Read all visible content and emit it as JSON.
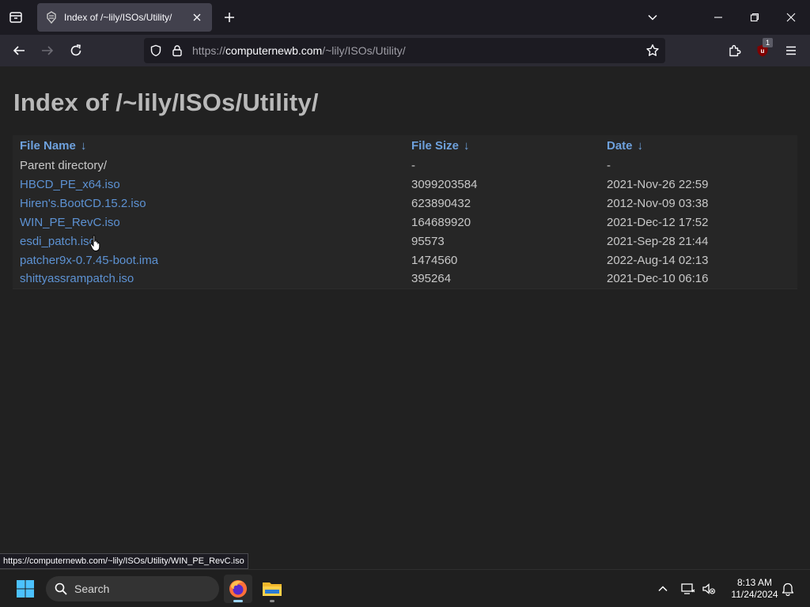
{
  "browser": {
    "tab_title": "Index of /~lily/ISOs/Utility/",
    "url_scheme": "https://",
    "url_host": "computernewb.com",
    "url_path": "/~lily/ISOs/Utility/",
    "extension_badge": "1"
  },
  "page": {
    "title": "Index of /~lily/ISOs/Utility/",
    "columns": [
      {
        "label": "File Name",
        "sort_arrow": "↓"
      },
      {
        "label": "File Size",
        "sort_arrow": "↓"
      },
      {
        "label": "Date",
        "sort_arrow": "↓"
      }
    ],
    "rows": [
      {
        "name": "Parent directory/",
        "size": "-",
        "date": "-"
      },
      {
        "name": "HBCD_PE_x64.iso",
        "size": "3099203584",
        "date": "2021-Nov-26 22:59"
      },
      {
        "name": "Hiren's.BootCD.15.2.iso",
        "size": "623890432",
        "date": "2012-Nov-09 03:38"
      },
      {
        "name": "WIN_PE_RevC.iso",
        "size": "164689920",
        "date": "2021-Dec-12 17:52"
      },
      {
        "name": "esdi_patch.iso",
        "size": "95573",
        "date": "2021-Sep-28 21:44"
      },
      {
        "name": "patcher9x-0.7.45-boot.ima",
        "size": "1474560",
        "date": "2022-Aug-14 02:13"
      },
      {
        "name": "shittyassrampatch.iso",
        "size": "395264",
        "date": "2021-Dec-10 06:16"
      }
    ]
  },
  "status_bar": "https://computernewb.com/~lily/ISOs/Utility/WIN_PE_RevC.iso",
  "taskbar": {
    "search_label": "Search",
    "time": "8:13 AM",
    "date": "11/24/2024"
  },
  "colors": {
    "link": "#5d92d3",
    "header_link": "#6ea1dd",
    "title": "#b9b9b9",
    "page_bg": "#212121"
  }
}
